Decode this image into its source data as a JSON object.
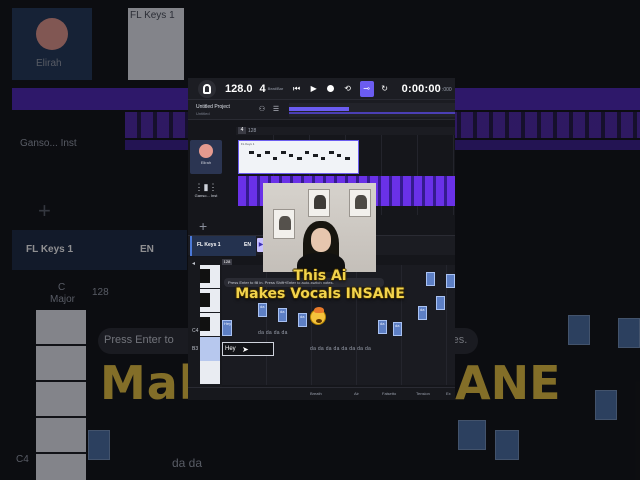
{
  "background": {
    "track_name": "Elirah",
    "track2_name": "Ganso... Inst",
    "track_label": "FL Keys 1",
    "lang": "EN",
    "key_label": "C",
    "key_sub": "Major",
    "pos": "128",
    "hint_fragment": "Press Enter to",
    "hint_fragment_right": "-switch notes.",
    "c4": "C4",
    "lyrics": "da da"
  },
  "transport": {
    "bpm": "128.0",
    "beats": "4",
    "beats_label": "Beat/Bar",
    "time": "0:00:00",
    "time_ms": ":000"
  },
  "project": {
    "name": "Untitled Project",
    "sub": "Untitled"
  },
  "ruler": {
    "pos_left": "4",
    "pos": "128"
  },
  "tracks": [
    {
      "name": "Elirah",
      "clip_label": "FL Keys 1"
    },
    {
      "name": "Ganso... Inst"
    }
  ],
  "piano_roll": {
    "track_name": "FL Keys 1",
    "lang": "EN",
    "pos": "128",
    "hint": "Press Enter to fill in. Press Shift+Enter to auto-switch notes.",
    "keys": [
      "C4",
      "B3"
    ],
    "input_value": "Hey",
    "lyrics_line1": "da da da da",
    "lyrics_line2": "da da da da da da da da",
    "notes": [
      "Hey",
      "da",
      "da",
      "da",
      "da",
      "da",
      "da"
    ]
  },
  "params": [
    "Breath",
    "Air",
    "Falsetto",
    "Tension",
    "Ex"
  ],
  "caption": {
    "line1": "This Ai",
    "line2": "Makes Vocals INSANE"
  },
  "overlay_text": {
    "big_left": "Make",
    "big_right": "ANE"
  }
}
